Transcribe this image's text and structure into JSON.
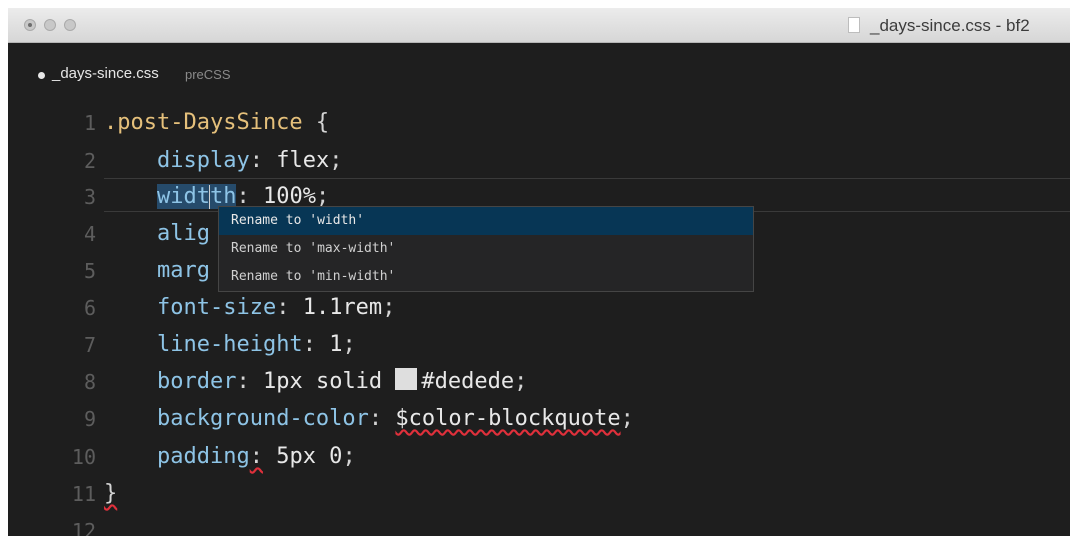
{
  "window": {
    "title": "_days-since.css - bf2"
  },
  "tab": {
    "filename": "_days-since.css",
    "language": "preCSS"
  },
  "editor": {
    "lines": [
      {
        "number": "1",
        "parts": [
          ".post-DaysSince",
          " {"
        ]
      },
      {
        "number": "2",
        "parts": [
          "display",
          ": ",
          "flex",
          ";"
        ]
      },
      {
        "number": "3",
        "parts": [
          "widt",
          "th",
          ": ",
          "100%",
          ";"
        ]
      },
      {
        "number": "4",
        "parts": [
          "alig"
        ]
      },
      {
        "number": "5",
        "parts": [
          "marg"
        ]
      },
      {
        "number": "6",
        "parts": [
          "font-size",
          ": ",
          "1.1rem",
          ";"
        ]
      },
      {
        "number": "7",
        "parts": [
          "line-height",
          ": ",
          "1",
          ";"
        ]
      },
      {
        "number": "8",
        "parts": [
          "border",
          ": ",
          "1px solid ",
          "#dedede",
          ";"
        ]
      },
      {
        "number": "9",
        "parts": [
          "background-color",
          ": ",
          "$color-blockquote",
          ";"
        ]
      },
      {
        "number": "10",
        "parts": [
          "padding",
          ":",
          " ",
          "5px 0",
          ";"
        ]
      },
      {
        "number": "11",
        "parts": [
          "}"
        ]
      },
      {
        "number": "12",
        "parts": [
          ""
        ]
      }
    ],
    "swatch_color": "#dedede"
  },
  "autocomplete": {
    "items": [
      {
        "label": "Rename to 'width'",
        "active": true
      },
      {
        "label": "Rename to 'max-width'",
        "active": false
      },
      {
        "label": "Rename to 'min-width'",
        "active": false
      }
    ]
  },
  "colors": {
    "background": "#1e1e1e",
    "selector": "#e5c07b",
    "property": "#8ec4e6",
    "error_squiggle": "#e0303b",
    "popup_active": "#073655"
  }
}
